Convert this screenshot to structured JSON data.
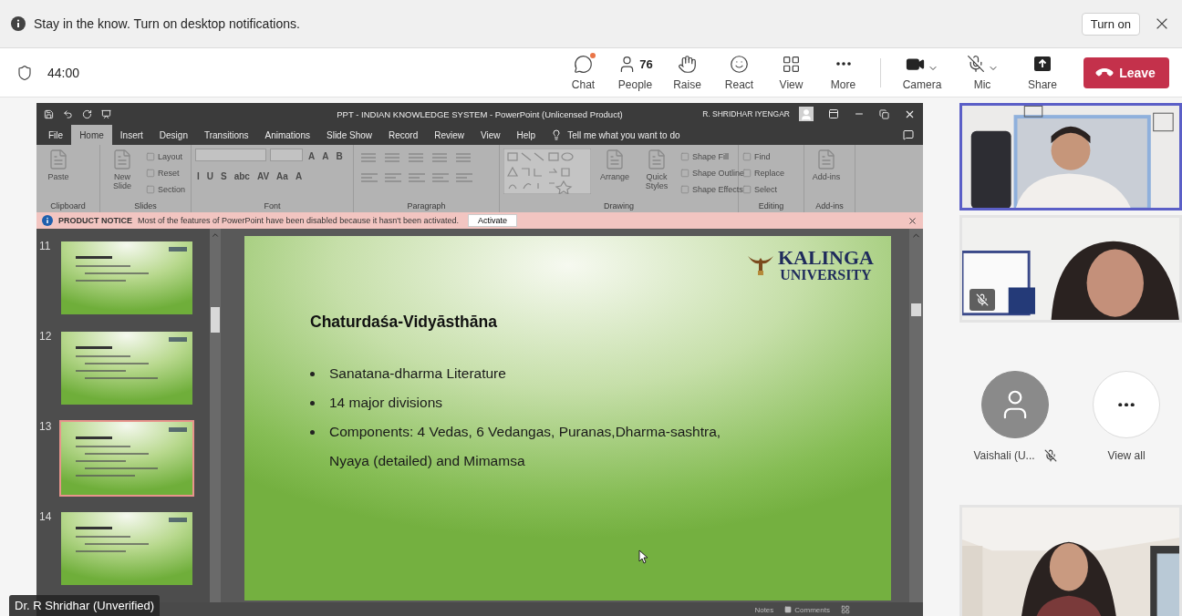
{
  "notification": {
    "text": "Stay in the know. Turn on desktop notifications.",
    "button": "Turn on"
  },
  "meeting_bar": {
    "timer": "44:00",
    "controls": [
      {
        "kind": "chat",
        "label": "Chat",
        "unread": true
      },
      {
        "kind": "people",
        "label": "People",
        "count": "76"
      },
      {
        "kind": "raise",
        "label": "Raise"
      },
      {
        "kind": "react",
        "label": "React"
      },
      {
        "kind": "view",
        "label": "View"
      },
      {
        "kind": "more",
        "label": "More"
      }
    ],
    "devices": [
      {
        "kind": "camera",
        "label": "Camera"
      },
      {
        "kind": "mic",
        "label": "Mic",
        "muted": true
      },
      {
        "kind": "share",
        "label": "Share"
      }
    ],
    "leave": "Leave"
  },
  "shared_screen": {
    "title": "PPT - INDIAN KNOWLEDGE SYSTEM - PowerPoint (Unlicensed Product)",
    "user": "R. SHRIDHAR IYENGAR",
    "tabs": [
      {
        "label": "File",
        "selected": false
      },
      {
        "label": "Home",
        "selected": true
      },
      {
        "label": "Insert",
        "selected": false
      },
      {
        "label": "Design",
        "selected": false
      },
      {
        "label": "Transitions",
        "selected": false
      },
      {
        "label": "Animations",
        "selected": false
      },
      {
        "label": "Slide Show",
        "selected": false
      },
      {
        "label": "Record",
        "selected": false
      },
      {
        "label": "Review",
        "selected": false
      },
      {
        "label": "View",
        "selected": false
      },
      {
        "label": "Help",
        "selected": false
      }
    ],
    "tell_me": "Tell me what you want to do",
    "ribbon_groups": [
      {
        "label": "Clipboard",
        "items": [
          {
            "kind": "large",
            "label": "Paste"
          }
        ]
      },
      {
        "label": "Slides",
        "items": [
          {
            "kind": "large",
            "label": "New Slide"
          },
          {
            "kind": "small",
            "label": "Layout"
          },
          {
            "kind": "small",
            "label": "Reset"
          },
          {
            "kind": "small",
            "label": "Section"
          }
        ]
      },
      {
        "label": "Font",
        "items": [
          {
            "kind": "field"
          },
          {
            "kind": "field"
          },
          {
            "kind": "format",
            "label": "A"
          },
          {
            "kind": "format",
            "label": "A"
          },
          {
            "kind": "format",
            "label": "B"
          },
          {
            "kind": "format",
            "label": "I"
          },
          {
            "kind": "format",
            "label": "U"
          },
          {
            "kind": "format",
            "label": "S"
          },
          {
            "kind": "format",
            "label": "abc"
          },
          {
            "kind": "format",
            "label": "AV"
          },
          {
            "kind": "format",
            "label": "Aa"
          },
          {
            "kind": "format",
            "label": "A"
          }
        ]
      },
      {
        "label": "Paragraph",
        "items": [
          {
            "kind": "icons"
          }
        ]
      },
      {
        "label": "Drawing",
        "items": [
          {
            "kind": "shapes"
          },
          {
            "kind": "large",
            "label": "Arrange"
          },
          {
            "kind": "large",
            "label": "Quick Styles"
          },
          {
            "kind": "small",
            "label": "Shape Fill"
          },
          {
            "kind": "small",
            "label": "Shape Outline"
          },
          {
            "kind": "small",
            "label": "Shape Effects"
          }
        ]
      },
      {
        "label": "Editing",
        "items": [
          {
            "kind": "small",
            "label": "Find"
          },
          {
            "kind": "small",
            "label": "Replace"
          },
          {
            "kind": "small",
            "label": "Select"
          }
        ]
      },
      {
        "label": "Add-ins",
        "items": [
          {
            "kind": "large",
            "label": "Add-ins"
          }
        ]
      }
    ],
    "notice": {
      "title": "PRODUCT NOTICE",
      "text": "Most of the features of PowerPoint have been disabled because it hasn't been activated.",
      "button": "Activate"
    },
    "thumbnails": [
      {
        "number": "11",
        "selected": false
      },
      {
        "number": "12",
        "selected": false
      },
      {
        "number": "13",
        "selected": true
      },
      {
        "number": "14",
        "selected": false
      }
    ],
    "slide": {
      "logo_title": "KALINGA",
      "logo_subtitle": "UNIVERSITY",
      "title": "Chaturdaśa-Vidyāsthāna",
      "bullets": [
        "Sanatana-dharma Literature",
        "14 major divisions",
        "Components: 4 Vedas, 6 Vedangas, Puranas,Dharma-sashtra, Nyaya (detailed) and Mimamsa"
      ]
    },
    "status": {
      "notes": "Notes",
      "comments": "Comments"
    },
    "presenter": "Dr. R Shridhar (Unverified)"
  },
  "participants": [
    {
      "kind": "video",
      "speaking": true
    },
    {
      "kind": "video",
      "speaking": false,
      "muted": true
    },
    {
      "kind": "avatar",
      "name": "Vaishali (U...",
      "muted": true
    },
    {
      "kind": "more",
      "label": "View all"
    },
    {
      "kind": "video",
      "speaking": false
    }
  ]
}
